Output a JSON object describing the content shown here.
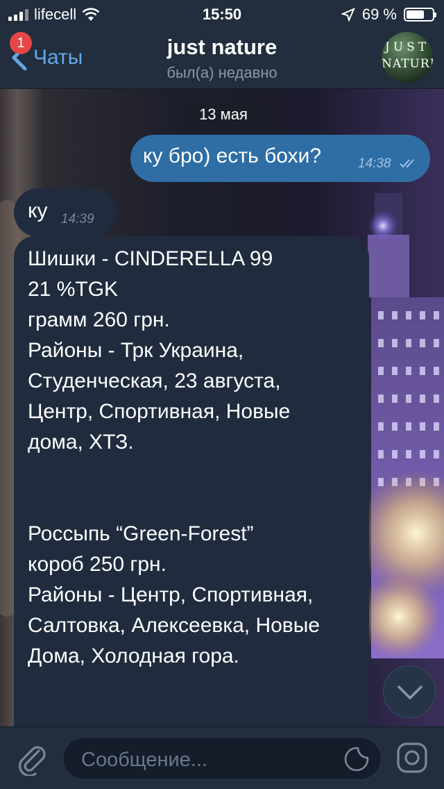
{
  "status_bar": {
    "carrier": "lifecell",
    "time": "15:50",
    "battery": "69 %",
    "battery_level": 0.69
  },
  "nav": {
    "back_label": "Чаты",
    "unread_badge": "1",
    "title": "just nature",
    "subtitle": "был(а) недавно",
    "avatar_line1": "JUST",
    "avatar_line2": "NATURE"
  },
  "chat": {
    "date_separator": "13 мая",
    "messages": [
      {
        "direction": "out",
        "text": "ку бро) есть бохи?",
        "time": "14:38",
        "status": "read"
      },
      {
        "direction": "in",
        "text": "ку",
        "time": "14:39"
      },
      {
        "direction": "in",
        "lines": [
          "Шишки - CINDERELLA 99",
          "21 %TGK",
          "грамм 260 грн.",
          "Районы - Трк Украина,",
          "Студенческая, 23 августа,",
          "Центр, Спортивная, Новые",
          "дома, ХТЗ.",
          "Россыпь “Green-Forest”",
          "короб 250 грн.",
          "Районы - Центр, Спортивная,",
          "Салтовка, Алексеевка, Новые",
          "Дома, Холодная гора."
        ]
      }
    ]
  },
  "input": {
    "placeholder": "Сообщение..."
  },
  "colors": {
    "accent": "#62a8eb",
    "outgoing_bubble": "#2f6ea5",
    "incoming_bubble": "#202c3e",
    "bars": "#222e3d",
    "badge": "#e64646"
  },
  "icons": [
    "chevron-left-icon",
    "wifi-icon",
    "location-arrow-icon",
    "double-check-icon",
    "chevron-down-icon",
    "paperclip-icon",
    "sticker-icon",
    "camera-icon"
  ]
}
